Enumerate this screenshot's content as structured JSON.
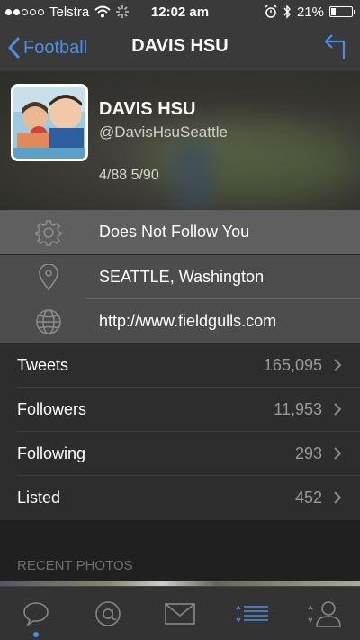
{
  "status_bar": {
    "carrier": "Telstra",
    "time": "12:02 am",
    "battery_text": "21%",
    "battery_level": 0.21
  },
  "nav": {
    "back_label": "Football",
    "title": "DAVIS HSU"
  },
  "profile": {
    "name": "DAVIS HSU",
    "handle": "@DavisHsuSeattle",
    "dates": "4/88 5/90"
  },
  "info": {
    "follow_status": "Does Not Follow You",
    "location": "SEATTLE, Washington",
    "url": "http://www.fieldgulls.com"
  },
  "stats": [
    {
      "label": "Tweets",
      "value": "165,095"
    },
    {
      "label": "Followers",
      "value": "11,953"
    },
    {
      "label": "Following",
      "value": "293"
    },
    {
      "label": "Listed",
      "value": "452"
    }
  ],
  "recent_photos": {
    "label": "RECENT PHOTOS"
  },
  "tabs": [
    {
      "icon": "chat-bubble-icon",
      "active": true
    },
    {
      "icon": "mentions-icon"
    },
    {
      "icon": "mail-icon"
    },
    {
      "icon": "list-icon"
    },
    {
      "icon": "profile-icon"
    }
  ],
  "colors": {
    "accent": "#4a90e2",
    "nav_bg": "#3a3a3a",
    "stats_bg": "#2d2d2d"
  }
}
